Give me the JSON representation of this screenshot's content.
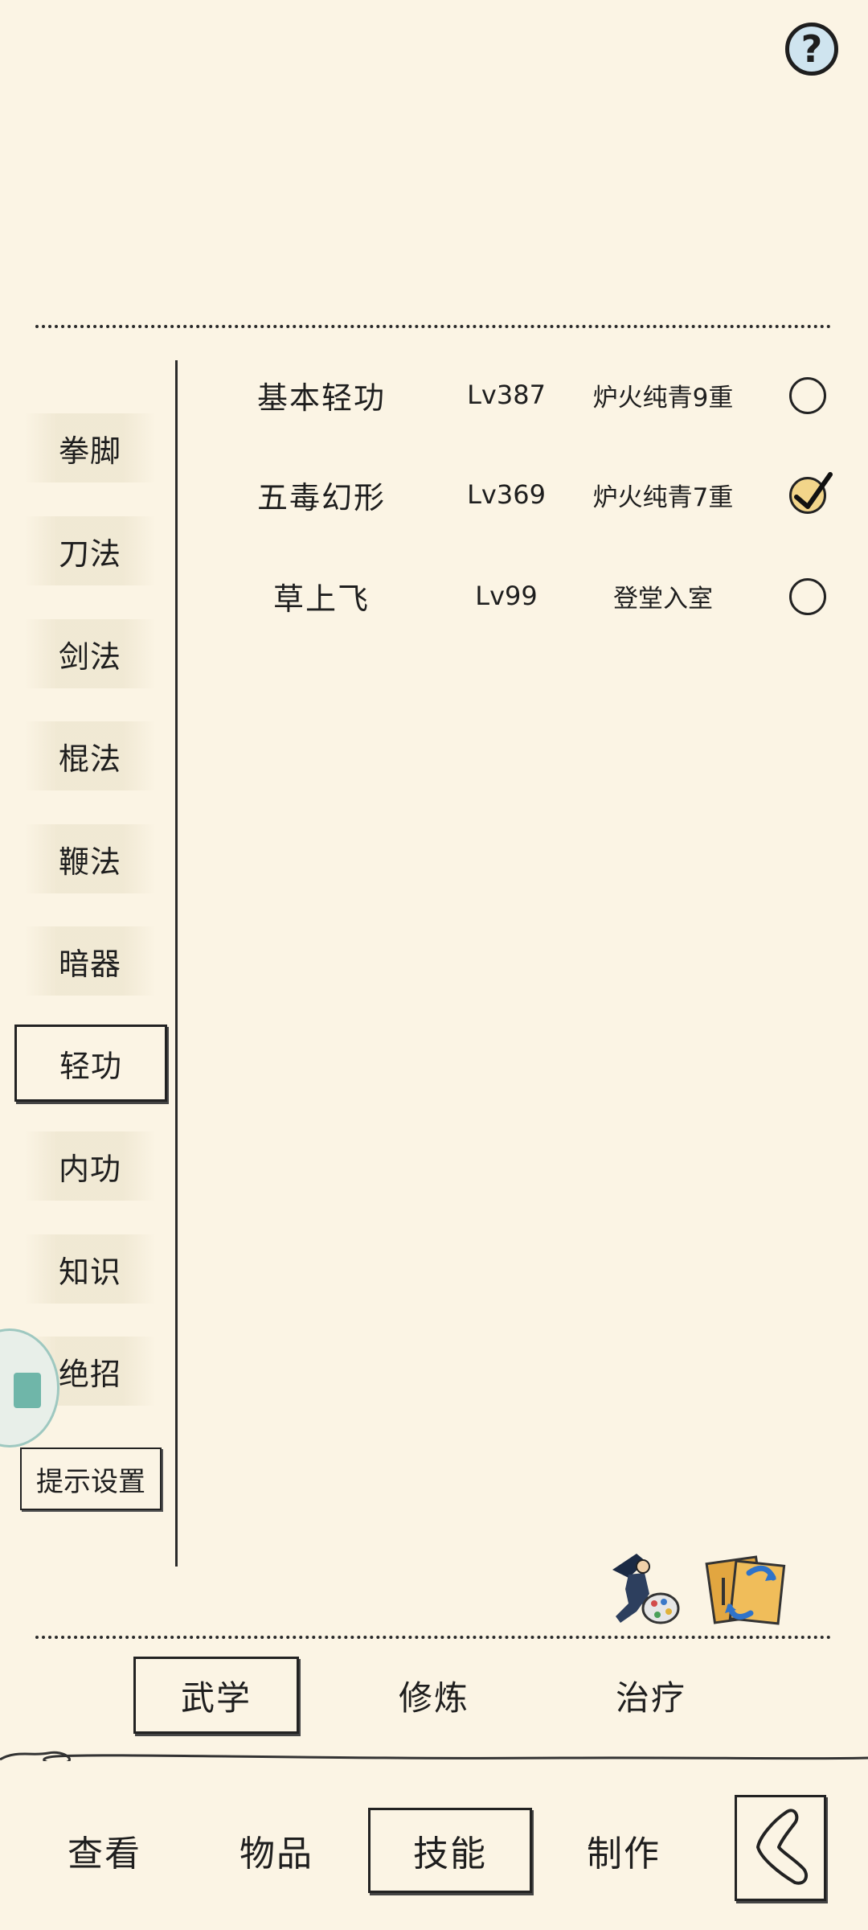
{
  "help": {
    "icon": "question-icon",
    "label": "?"
  },
  "categories": [
    {
      "label": "拳脚",
      "selected": false
    },
    {
      "label": "刀法",
      "selected": false
    },
    {
      "label": "剑法",
      "selected": false
    },
    {
      "label": "棍法",
      "selected": false
    },
    {
      "label": "鞭法",
      "selected": false
    },
    {
      "label": "暗器",
      "selected": false
    },
    {
      "label": "轻功",
      "selected": true
    },
    {
      "label": "内功",
      "selected": false
    },
    {
      "label": "知识",
      "selected": false
    },
    {
      "label": "绝招",
      "selected": false
    }
  ],
  "tip_settings_label": "提示设置",
  "skills": [
    {
      "name": "基本轻功",
      "level": "Lv387",
      "rank": "炉火纯青9重",
      "checked": false
    },
    {
      "name": "五毒幻形",
      "level": "Lv369",
      "rank": "炉火纯青7重",
      "checked": true
    },
    {
      "name": "草上飞",
      "level": "Lv99",
      "rank": "登堂入室",
      "checked": false
    }
  ],
  "tools": [
    {
      "icon": "martial-artist-palette-icon"
    },
    {
      "icon": "book-swap-icon"
    }
  ],
  "sub_tabs": [
    {
      "label": "武学",
      "active": true
    },
    {
      "label": "修炼",
      "active": false
    },
    {
      "label": "治疗",
      "active": false
    }
  ],
  "nav": [
    {
      "label": "查看",
      "active": false
    },
    {
      "label": "物品",
      "active": false
    },
    {
      "label": "技能",
      "active": true
    },
    {
      "label": "制作",
      "active": false
    }
  ],
  "back_icon": "back-arrow-icon",
  "colors": {
    "background": "#fbf4e4",
    "ink": "#1e1e1e",
    "help_fill": "#cfe4ef",
    "checked_fill": "#f2d58a"
  }
}
